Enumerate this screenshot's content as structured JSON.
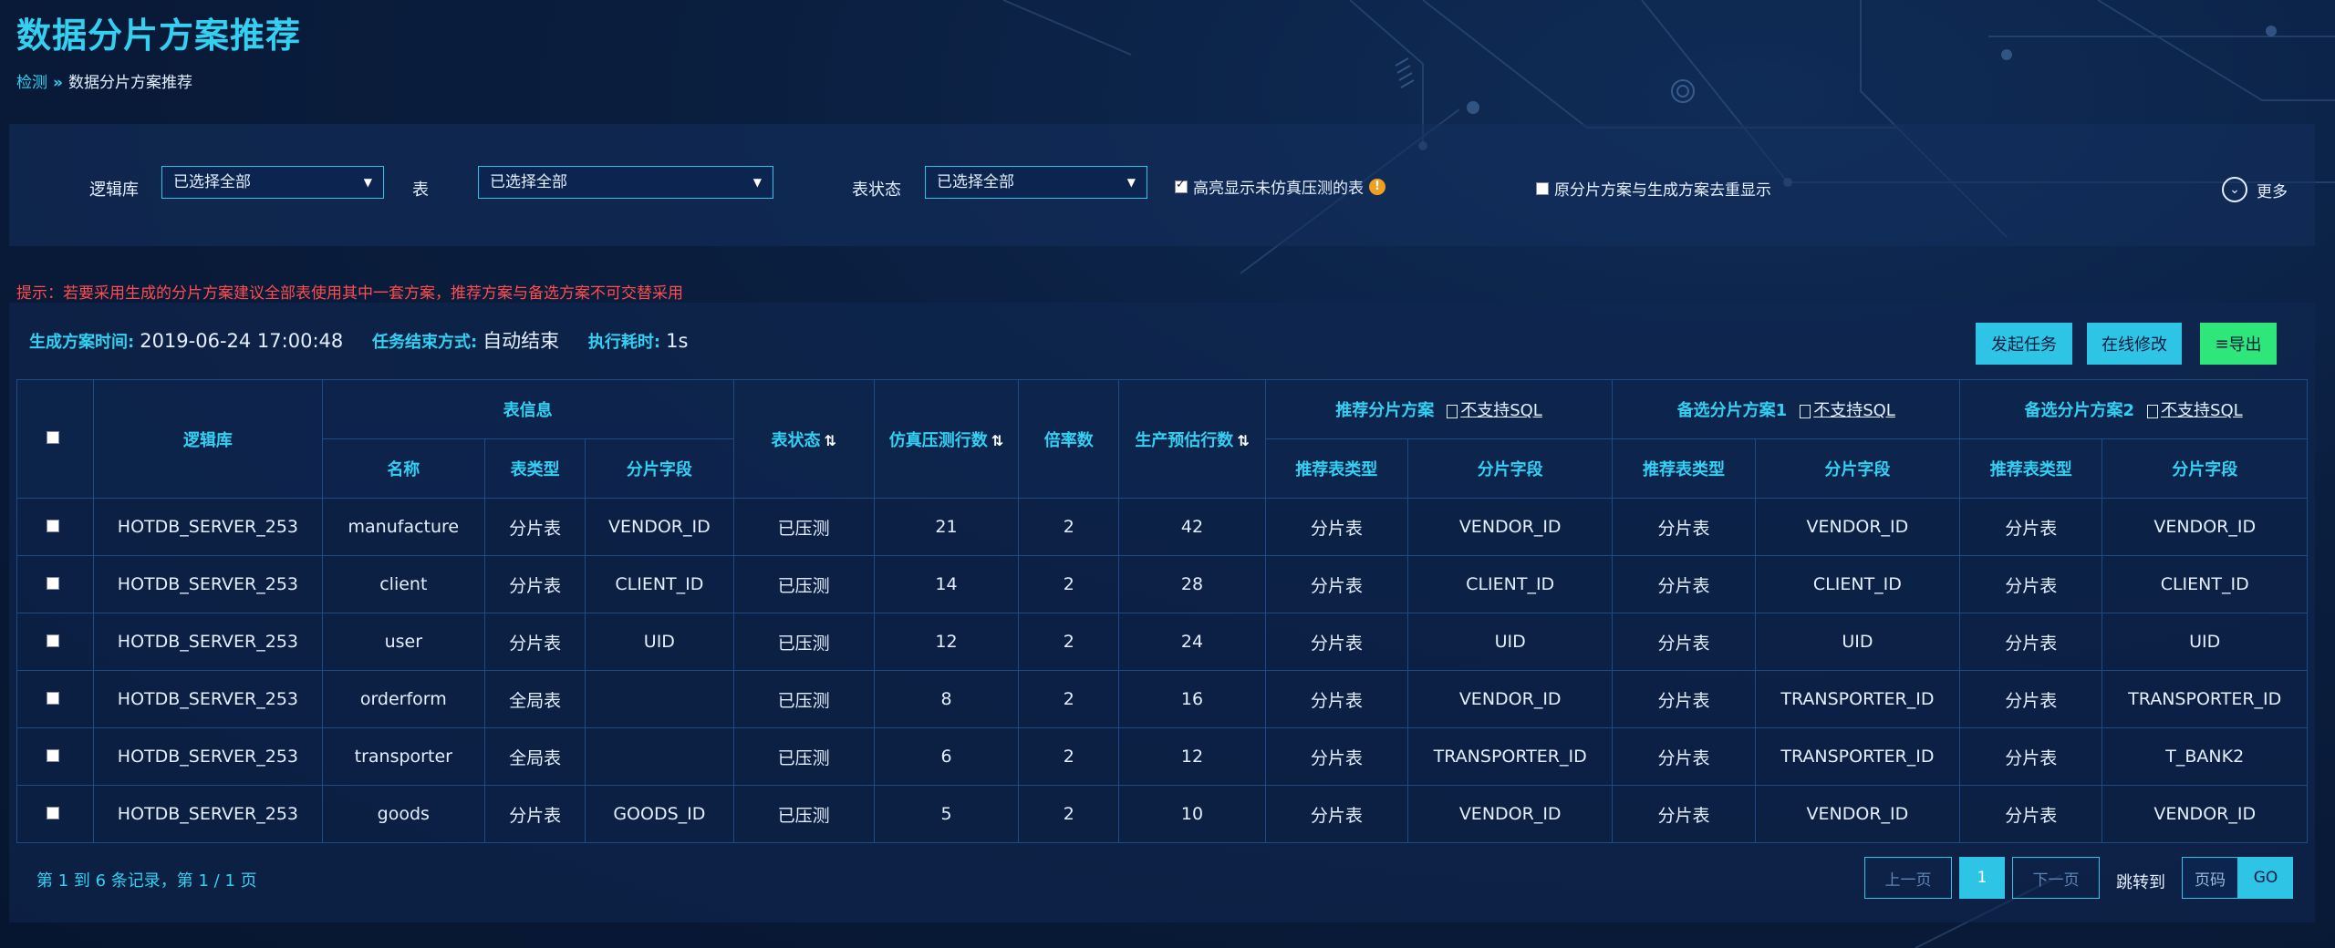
{
  "page": {
    "title": "数据分片方案推荐",
    "breadcrumb": {
      "parent": "检测",
      "separator": "»",
      "current": "数据分片方案推荐"
    }
  },
  "filters": {
    "logic_db_label": "逻辑库",
    "logic_db_value": "已选择全部",
    "table_label": "表",
    "table_value": "已选择全部",
    "status_label": "表状态",
    "status_value": "已选择全部",
    "highlight_label": "高亮显示未仿真压测的表",
    "dedupe_label": "原分片方案与生成方案去重显示",
    "more_label": "更多"
  },
  "tip": "提示：若要采用生成的分片方案建议全部表使用其中一套方案，推荐方案与备选方案不可交替采用",
  "meta": {
    "gen_time_label": "生成方案时间:",
    "gen_time": "2019-06-24 17:00:48",
    "end_mode_label": "任务结束方式:",
    "end_mode": "自动结束",
    "duration_label": "执行耗时:",
    "duration": "1s"
  },
  "actions": {
    "start": "发起任务",
    "edit": "在线修改",
    "export": "导出"
  },
  "table": {
    "headers": {
      "logic_db": "逻辑库",
      "table_info": "表信息",
      "name": "名称",
      "type": "表类型",
      "shard_field": "分片字段",
      "status": "表状态",
      "sim_rows": "仿真压测行数",
      "multiplier": "倍率数",
      "prod_rows": "生产预估行数",
      "rec_plan": "推荐分片方案",
      "alt_plan1": "备选分片方案1",
      "alt_plan2": "备选分片方案2",
      "not_supported": "不支持SQL",
      "rec_type": "推荐表类型"
    },
    "rows": [
      {
        "db": "HOTDB_SERVER_253",
        "name": "manufacture",
        "type": "分片表",
        "field": "VENDOR_ID",
        "status": "已压测",
        "sim": "21",
        "mult": "2",
        "prod": "42",
        "r_type": "分片表",
        "r_field": "VENDOR_ID",
        "a1_type": "分片表",
        "a1_field": "VENDOR_ID",
        "a2_type": "分片表",
        "a2_field": "VENDOR_ID"
      },
      {
        "db": "HOTDB_SERVER_253",
        "name": "client",
        "type": "分片表",
        "field": "CLIENT_ID",
        "status": "已压测",
        "sim": "14",
        "mult": "2",
        "prod": "28",
        "r_type": "分片表",
        "r_field": "CLIENT_ID",
        "a1_type": "分片表",
        "a1_field": "CLIENT_ID",
        "a2_type": "分片表",
        "a2_field": "CLIENT_ID"
      },
      {
        "db": "HOTDB_SERVER_253",
        "name": "user",
        "type": "分片表",
        "field": "UID",
        "status": "已压测",
        "sim": "12",
        "mult": "2",
        "prod": "24",
        "r_type": "分片表",
        "r_field": "UID",
        "a1_type": "分片表",
        "a1_field": "UID",
        "a2_type": "分片表",
        "a2_field": "UID"
      },
      {
        "db": "HOTDB_SERVER_253",
        "name": "orderform",
        "type": "全局表",
        "field": "",
        "status": "已压测",
        "sim": "8",
        "mult": "2",
        "prod": "16",
        "r_type": "分片表",
        "r_field": "VENDOR_ID",
        "a1_type": "分片表",
        "a1_field": "TRANSPORTER_ID",
        "a2_type": "分片表",
        "a2_field": "TRANSPORTER_ID"
      },
      {
        "db": "HOTDB_SERVER_253",
        "name": "transporter",
        "type": "全局表",
        "field": "",
        "status": "已压测",
        "sim": "6",
        "mult": "2",
        "prod": "12",
        "r_type": "分片表",
        "r_field": "TRANSPORTER_ID",
        "a1_type": "分片表",
        "a1_field": "TRANSPORTER_ID",
        "a2_type": "分片表",
        "a2_field": "T_BANK2"
      },
      {
        "db": "HOTDB_SERVER_253",
        "name": "goods",
        "type": "分片表",
        "field": "GOODS_ID",
        "status": "已压测",
        "sim": "5",
        "mult": "2",
        "prod": "10",
        "r_type": "分片表",
        "r_field": "VENDOR_ID",
        "a1_type": "分片表",
        "a1_field": "VENDOR_ID",
        "a2_type": "分片表",
        "a2_field": "VENDOR_ID"
      }
    ]
  },
  "pagination": {
    "summary": "第 1 到 6 条记录，第 1 / 1 页",
    "prev": "上一页",
    "current": "1",
    "next": "下一页",
    "jump_label": "跳转到",
    "page_placeholder": "页码",
    "go": "GO"
  }
}
